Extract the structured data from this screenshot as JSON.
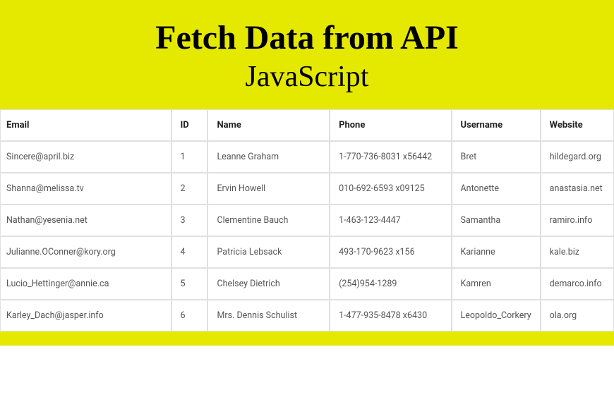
{
  "header": {
    "title": "Fetch Data from API",
    "subtitle": "JavaScript"
  },
  "table": {
    "headers": {
      "email": "Email",
      "id": "ID",
      "name": "Name",
      "phone": "Phone",
      "username": "Username",
      "website": "Website"
    },
    "rows": [
      {
        "email": "Sincere@april.biz",
        "id": "1",
        "name": "Leanne Graham",
        "phone": "1-770-736-8031 x56442",
        "username": "Bret",
        "website": "hildegard.org"
      },
      {
        "email": "Shanna@melissa.tv",
        "id": "2",
        "name": "Ervin Howell",
        "phone": "010-692-6593 x09125",
        "username": "Antonette",
        "website": "anastasia.net"
      },
      {
        "email": "Nathan@yesenia.net",
        "id": "3",
        "name": "Clementine Bauch",
        "phone": "1-463-123-4447",
        "username": "Samantha",
        "website": "ramiro.info"
      },
      {
        "email": "Julianne.OConner@kory.org",
        "id": "4",
        "name": "Patricia Lebsack",
        "phone": "493-170-9623 x156",
        "username": "Karianne",
        "website": "kale.biz"
      },
      {
        "email": "Lucio_Hettinger@annie.ca",
        "id": "5",
        "name": "Chelsey Dietrich",
        "phone": "(254)954-1289",
        "username": "Kamren",
        "website": "demarco.info"
      },
      {
        "email": "Karley_Dach@jasper.info",
        "id": "6",
        "name": "Mrs. Dennis Schulist",
        "phone": "1-477-935-8478 x6430",
        "username": "Leopoldo_Corkery",
        "website": "ola.org"
      }
    ]
  }
}
